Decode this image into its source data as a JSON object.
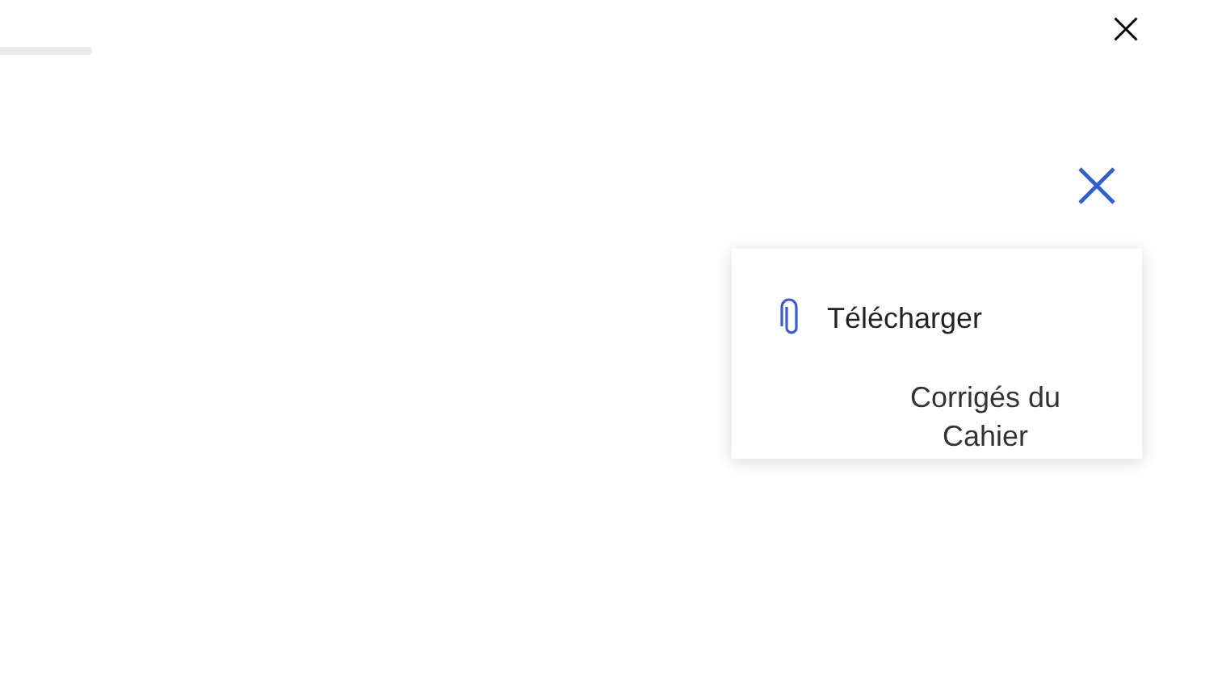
{
  "menu": {
    "items": [
      {
        "kind": "attachment",
        "label": "Télécharger"
      },
      {
        "kind": "text",
        "label": "Corrigés du Cahier"
      }
    ]
  }
}
